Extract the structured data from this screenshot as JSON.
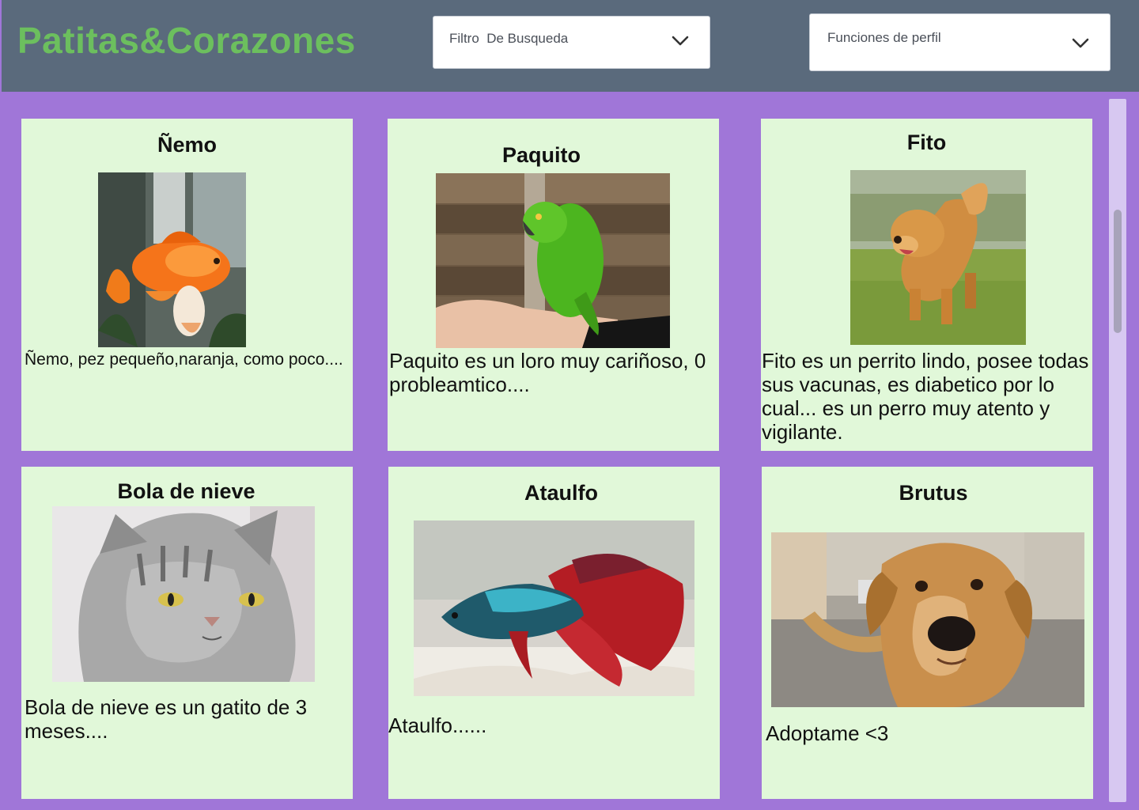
{
  "header": {
    "brand": "Patitas&Corazones",
    "filter_dropdown": {
      "selected": "Filtro  De Busqueda"
    },
    "profile_dropdown": {
      "selected": "Funciones de perfil"
    }
  },
  "colors": {
    "background": "#a076d8",
    "topbar": "#5a6a7c",
    "brand": "#6cbf5e",
    "card": "#e1f8d9"
  },
  "pets": [
    {
      "name": "Ñemo",
      "description": "Ñemo, pez pequeño,naranja, como poco....",
      "photo": "goldfish-photo"
    },
    {
      "name": "Paquito",
      "description": "Paquito es un loro muy cariñoso, 0 probleamtico....",
      "photo": "green-parrot-photo"
    },
    {
      "name": "Fito",
      "description": "Fito es un perrito lindo, posee todas sus vacunas, es diabetico por lo cual... es un perro muy atento y vigilante.",
      "photo": "golden-retriever-photo"
    },
    {
      "name": "Bola de nieve",
      "description": "Bola de nieve es un gatito de 3 meses....",
      "photo": "grey-cat-photo"
    },
    {
      "name": "Ataulfo",
      "description": "Ataulfo......",
      "photo": "betta-fish-photo"
    },
    {
      "name": "Brutus",
      "description": "Adoptame <3",
      "photo": "brown-dog-photo"
    }
  ]
}
